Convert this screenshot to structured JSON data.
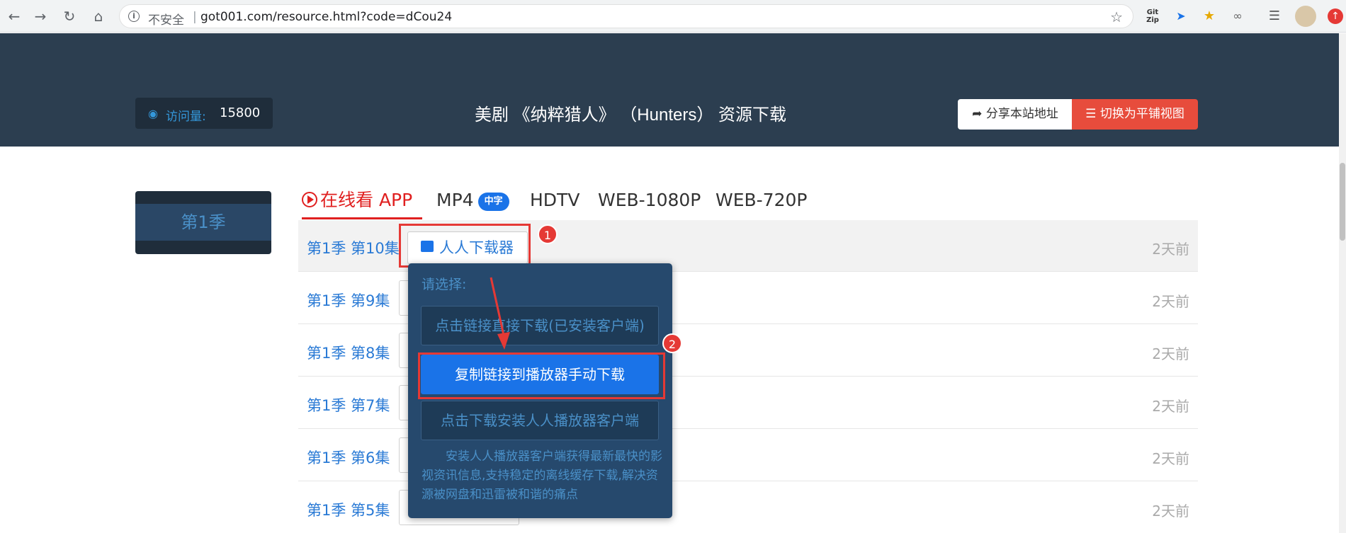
{
  "browser": {
    "security_label": "不安全",
    "separator": "|",
    "url": "got001.com/resource.html?code=dCou24",
    "extensions": [
      "Git Zip",
      "send-icon",
      "fox-icon",
      "bike-icon",
      "playlist-icon",
      "profile-avatar",
      "update-icon"
    ]
  },
  "header": {
    "visits_label": "访问量:",
    "visits_value": "15800",
    "title": "美剧 《纳粹猎人》 （Hunters） 资源下载",
    "share_label": "分享本站地址",
    "view_label": "切换为平铺视图"
  },
  "sidebar": {
    "season": "第1季"
  },
  "tabs": [
    {
      "label": "在线看 APP",
      "active": true
    },
    {
      "label": "MP4",
      "badge": "中字"
    },
    {
      "label": "HDTV"
    },
    {
      "label": "WEB-1080P"
    },
    {
      "label": "WEB-720P"
    }
  ],
  "episodes": [
    {
      "label": "第1季 第10集",
      "time": "2天前",
      "button": "人人下载器"
    },
    {
      "label": "第1季 第9集",
      "time": "2天前"
    },
    {
      "label": "第1季 第8集",
      "time": "2天前"
    },
    {
      "label": "第1季 第7集",
      "time": "2天前"
    },
    {
      "label": "第1季 第6集",
      "time": "2天前"
    },
    {
      "label": "第1季 第5集",
      "time": "2天前"
    }
  ],
  "popup": {
    "title": "请选择:",
    "options": [
      "点击链接直接下载(已安装客户端)",
      "复制链接到播放器手动下载",
      "点击下载安装人人播放器客户端"
    ],
    "note": "安装人人播放器客户端获得最新最快的影视资讯信息,支持稳定的离线缓存下载,解决资源被网盘和迅雷被和谐的痛点"
  },
  "annotations": {
    "marker1": "1",
    "marker2": "2"
  },
  "colors": {
    "header_bg": "#2c3e50",
    "accent_red": "#e74c3c",
    "link_blue": "#2a7ad5",
    "primary_blue": "#1a73e8",
    "popup_bg": "#26496d"
  }
}
